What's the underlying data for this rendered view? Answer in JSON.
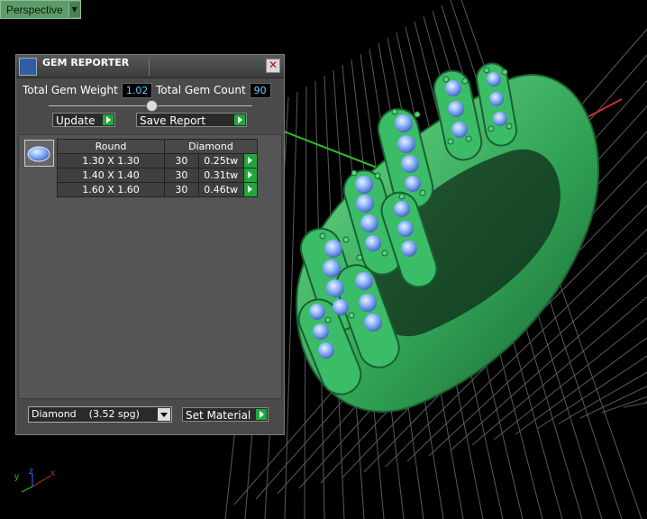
{
  "viewport": {
    "view_label": "Perspective"
  },
  "axes": {
    "y": "y",
    "z": "z",
    "x": "x"
  },
  "panel": {
    "title": "GEM REPORTER",
    "total_weight_label": "Total Gem Weight",
    "total_weight_value": "1.02",
    "total_count_label": "Total Gem Count",
    "total_count_value": "90",
    "update_label": "Update",
    "save_report_label": "Save Report",
    "table": {
      "columns": [
        "Round",
        "Diamond"
      ],
      "rows": [
        {
          "size": "1.30 X 1.30",
          "count": "30",
          "weight": "0.25tw"
        },
        {
          "size": "1.40 X 1.40",
          "count": "30",
          "weight": "0.31tw"
        },
        {
          "size": "1.60 X 1.60",
          "count": "30",
          "weight": "0.46tw"
        }
      ]
    },
    "material": {
      "selected": "Diamond    (3.52 spg)",
      "set_material_label": "Set Material"
    }
  },
  "colors": {
    "accent_green": "#1fa83a",
    "value_cyan": "#66ccff",
    "model_green": "#2fa85a",
    "gem_blue": "#7aa7ff"
  }
}
